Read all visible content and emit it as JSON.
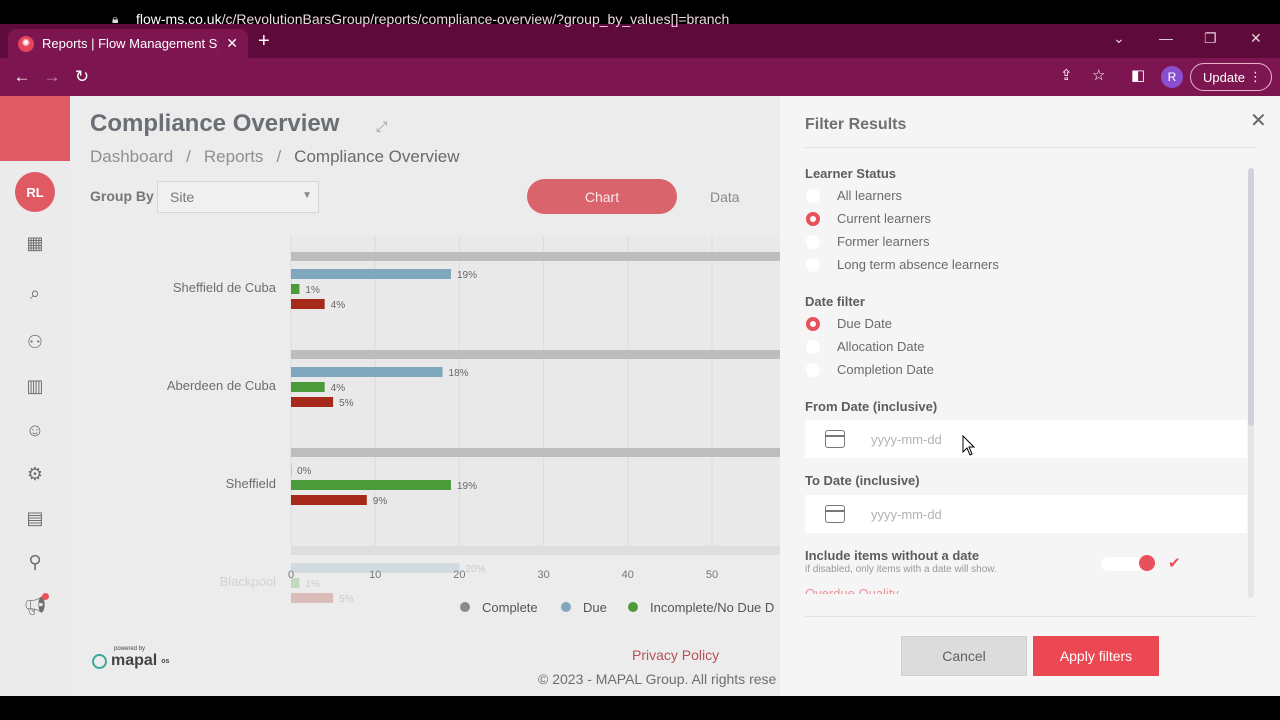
{
  "browser": {
    "tab_title": "Reports | Flow Management Syste",
    "url_host": "flow-ms.co.uk",
    "url_path": "/c/RevolutionBarsGroup/reports/compliance-overview/?group_by_values[]=branch",
    "profile_initial": "R",
    "update_label": "Update"
  },
  "sidebar": {
    "avatar_initials": "RL",
    "icons": [
      "dashboard-icon",
      "search-report-icon",
      "people-icon",
      "bar-chart-icon",
      "smiley-icon",
      "gear-icon",
      "building-icon",
      "search-icon",
      "megaphone-icon"
    ]
  },
  "main": {
    "title": "Compliance Overview",
    "breadcrumb": [
      "Dashboard",
      "/",
      "Reports",
      "/",
      "Compliance Overview"
    ],
    "group_by_label": "Group By",
    "group_by_value": "Site",
    "view_tabs": [
      "Chart",
      "Data"
    ],
    "powered_by": "powered by",
    "brand": "mapal",
    "brand_suffix": "os",
    "privacy": "Privacy Policy",
    "copyright": "© 2023 - MAPAL Group. All rights rese"
  },
  "chart_data": {
    "type": "bar",
    "orientation": "horizontal",
    "categories": [
      "Sheffield de Cuba",
      "Aberdeen de Cuba",
      "Sheffield",
      "Blackpool"
    ],
    "series": [
      {
        "name": "Complete",
        "values": [
          null,
          null,
          null,
          null
        ]
      },
      {
        "name": "Due",
        "values": [
          19,
          18,
          0,
          20
        ]
      },
      {
        "name": "Incomplete/No Due D",
        "values": [
          1,
          4,
          19,
          1
        ]
      },
      {
        "name": "",
        "values": [
          4,
          5,
          9,
          5
        ]
      }
    ],
    "x_ticks": [
      0,
      10,
      20,
      30,
      40,
      50
    ],
    "xlim": [
      0,
      60
    ],
    "grid": true,
    "legend": "bottom",
    "colors": {
      "Complete": "#8a8a8a",
      "Due": "#7fa7bd",
      "Incomplete/No Due D": "#4d9a3a",
      "Overdue": "#a52a1c"
    }
  },
  "panel": {
    "title": "Filter Results",
    "learner_status_label": "Learner Status",
    "learner_status_options": [
      "All learners",
      "Current learners",
      "Former learners",
      "Long term absence learners"
    ],
    "learner_status_selected": "Current learners",
    "date_filter_label": "Date filter",
    "date_filter_options": [
      "Due Date",
      "Allocation Date",
      "Completion Date"
    ],
    "date_filter_selected": "Due Date",
    "from_label": "From Date (inclusive)",
    "from_placeholder": "yyyy-mm-dd",
    "to_label": "To Date (inclusive)",
    "to_placeholder": "yyyy-mm-dd",
    "include_label": "Include items without a date",
    "include_hint": "if disabled, only items with a date will show.",
    "include_enabled": true,
    "cut_text": "Overdue Quality",
    "cancel_label": "Cancel",
    "apply_label": "Apply filters"
  }
}
